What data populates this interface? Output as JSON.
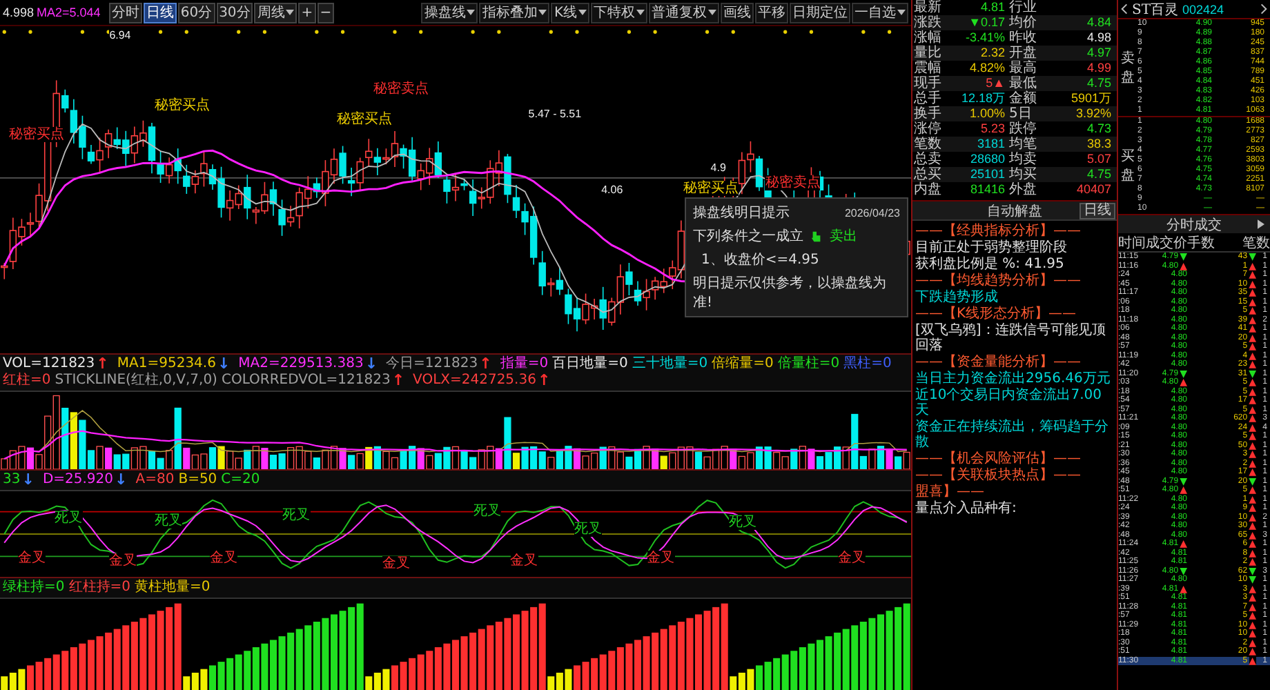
{
  "toolbar": {
    "readouts": [
      {
        "text": "4.998",
        "color": "#e8e8e8"
      },
      {
        "text": "MA2=5.044",
        "color": "#ff30ff"
      }
    ],
    "period_tabs": [
      {
        "label": "分时",
        "selected": false,
        "dropdown": false
      },
      {
        "label": "日线",
        "selected": true,
        "dropdown": false
      },
      {
        "label": "60分",
        "selected": false,
        "dropdown": false
      },
      {
        "label": "30分",
        "selected": false,
        "dropdown": false
      },
      {
        "label": "周线",
        "selected": false,
        "dropdown": true
      }
    ],
    "zoom_buttons": [
      "+",
      "−"
    ],
    "tools": [
      {
        "label": "操盘线",
        "dropdown": true
      },
      {
        "label": "指标叠加",
        "dropdown": true
      },
      {
        "label": "K线",
        "dropdown": true
      },
      {
        "label": "下特权",
        "dropdown": true
      },
      {
        "label": "普通复权",
        "dropdown": true
      },
      {
        "label": "画线",
        "dropdown": false
      },
      {
        "label": "平移",
        "dropdown": false
      },
      {
        "label": "日期定位",
        "dropdown": false
      },
      {
        "label": "一自选",
        "dropdown": true
      }
    ]
  },
  "main_chart": {
    "labels": [
      {
        "text": "秘密买点",
        "kind": "sell"
      },
      {
        "text": "秘密买点",
        "kind": "buy"
      },
      {
        "text": "秘密卖点",
        "kind": "sell"
      },
      {
        "text": "秘密买点",
        "kind": "buy"
      },
      {
        "text": "秘密买点",
        "kind": "buy"
      },
      {
        "text": "秘密卖点",
        "kind": "sell"
      }
    ],
    "price_marks": [
      "6.94",
      "5.47 - 5.51",
      "4.06",
      "4.9"
    ]
  },
  "volume_indicator": {
    "items": [
      {
        "text": "VOL=121823",
        "color": "#e8e8e8",
        "arrow": {
          "text": "↑",
          "color": "#ff3030"
        }
      },
      {
        "text": "MA1=95234.6",
        "color": "#e8c800",
        "arrow": {
          "text": "↓",
          "color": "#4080ff"
        }
      },
      {
        "text": "MA2=229513.383",
        "color": "#ff30ff",
        "arrow": {
          "text": "↓",
          "color": "#4080ff"
        }
      },
      {
        "text": "今日=121823",
        "color": "#a0a0a0",
        "arrow": {
          "text": "↑",
          "color": "#ff3030"
        }
      },
      {
        "text": "指量=0",
        "color": "#ff30ff"
      },
      {
        "text": "百日地量=0",
        "color": "#e8e8e8"
      },
      {
        "text": "三十地量=0",
        "color": "#00d8d8"
      },
      {
        "text": "倍缩量=0",
        "color": "#e8c800"
      },
      {
        "text": "倍量柱=0",
        "color": "#20e020"
      },
      {
        "text": "黑柱=0",
        "color": "#4060ff"
      },
      {
        "text": "红柱=0",
        "color": "#ff4040"
      },
      {
        "text": "STICKLINE(红柱,0,V,7,0)",
        "color": "#a0a0a0"
      },
      {
        "text": "COLORREDVOL=121823",
        "color": "#a0a0a0",
        "arrow": {
          "text": "↑",
          "color": "#ff3030"
        }
      },
      {
        "text": "VOLX=242725.36",
        "color": "#ff4040",
        "arrow": {
          "text": "↑",
          "color": "#ff3030"
        }
      }
    ]
  },
  "kdj_indicator": {
    "items": [
      {
        "text": "33",
        "color": "#20e020",
        "arrow": {
          "text": "↓",
          "color": "#4080ff"
        }
      },
      {
        "text": "D=25.920",
        "color": "#ff30ff",
        "arrow": {
          "text": "↓",
          "color": "#4080ff"
        }
      },
      {
        "text": "A=80",
        "color": "#ff4040"
      },
      {
        "text": "B=50",
        "color": "#e8c800"
      },
      {
        "text": "C=20",
        "color": "#20e020"
      }
    ],
    "labels": [
      {
        "text": "金叉",
        "kind": "golden"
      },
      {
        "text": "死叉",
        "kind": "death"
      },
      {
        "text": "金叉",
        "kind": "golden"
      },
      {
        "text": "死叉",
        "kind": "death"
      },
      {
        "text": "金叉",
        "kind": "golden"
      },
      {
        "text": "死叉",
        "kind": "death"
      },
      {
        "text": "金叉",
        "kind": "golden"
      },
      {
        "text": "死叉",
        "kind": "death"
      },
      {
        "text": "金叉",
        "kind": "golden"
      },
      {
        "text": "死叉",
        "kind": "death"
      },
      {
        "text": "金叉",
        "kind": "golden"
      },
      {
        "text": "死叉",
        "kind": "death"
      },
      {
        "text": "金叉",
        "kind": "golden"
      }
    ]
  },
  "bar_indicator": {
    "items": [
      {
        "text": "绿柱持=0",
        "color": "#20e020"
      },
      {
        "text": "红柱持=0",
        "color": "#ff4040"
      },
      {
        "text": "黄柱地量=0",
        "color": "#e8c800"
      }
    ]
  },
  "tooltip": {
    "title": "操盘线明日提示",
    "date": "2026/04/23",
    "condition": "下列条件之一成立",
    "signal": "卖出",
    "rule": "1、收盘价<=4.95",
    "note": "明日提示仅供参考，以操盘线为准!"
  },
  "quote": {
    "rows": [
      [
        {
          "label": "最新",
          "value": "4.81",
          "color": "#20e020"
        },
        {
          "label": "行业"
        }
      ],
      [
        {
          "label": "涨跌",
          "value": "▼0.17",
          "color": "#20e020"
        },
        {
          "label": "均价",
          "value": "4.84",
          "color": "#20e020"
        }
      ],
      [
        {
          "label": "涨幅",
          "value": "-3.41%",
          "color": "#20e020"
        },
        {
          "label": "昨收",
          "value": "4.98",
          "color": "#e8e8e8"
        }
      ],
      [
        {
          "label": "量比",
          "value": "2.32",
          "color": "#e8c800"
        },
        {
          "label": "开盘",
          "value": "4.97",
          "color": "#20e020"
        }
      ],
      [
        {
          "label": "震幅",
          "value": "4.82%",
          "color": "#e8c800"
        },
        {
          "label": "最高",
          "value": "4.99",
          "color": "#ff4040"
        }
      ],
      [
        {
          "label": "现手",
          "value": "5▲",
          "color": "#ff4040"
        },
        {
          "label": "最低",
          "value": "4.75",
          "color": "#20e020"
        }
      ],
      [
        {
          "label": "总手",
          "value": "12.18万",
          "color": "#00d8d8"
        },
        {
          "label": "金额",
          "value": "5901万",
          "color": "#e8c800"
        }
      ],
      [
        {
          "label": "换手",
          "value": "1.00%",
          "color": "#e8c800"
        },
        {
          "label": "5日",
          "value": "3.92%",
          "color": "#e8c800"
        }
      ],
      [
        {
          "label": "涨停",
          "value": "5.23",
          "color": "#ff4040"
        },
        {
          "label": "跌停",
          "value": "4.73",
          "color": "#20e020"
        }
      ],
      [
        {
          "label": "笔数",
          "value": "3181",
          "color": "#00d8d8"
        },
        {
          "label": "均笔",
          "value": "38.3",
          "color": "#e8c800"
        }
      ],
      [
        {
          "label": "总卖",
          "value": "28680",
          "color": "#00d8d8"
        },
        {
          "label": "均卖",
          "value": "5.07",
          "color": "#ff4040"
        }
      ],
      [
        {
          "label": "总买",
          "value": "25101",
          "color": "#00d8d8"
        },
        {
          "label": "均买",
          "value": "4.75",
          "color": "#20e020"
        }
      ],
      [
        {
          "label": "内盘",
          "value": "81416",
          "color": "#20e020"
        },
        {
          "label": "外盘",
          "value": "40407",
          "color": "#ff4040"
        }
      ]
    ]
  },
  "auto_analysis": {
    "title": "自动解盘",
    "button": "日线",
    "lines": [
      {
        "text": "——【经典指标分析】——",
        "kind": "heading"
      },
      {
        "text": "目前正处于弱势整理阶段",
        "kind": "normal"
      },
      {
        "text": "获利盘比例是 %: 41.95",
        "kind": "normal"
      },
      {
        "text": "——【均线趋势分析】——",
        "kind": "heading"
      },
      {
        "text": "下跌趋势形成",
        "kind": "highlight"
      },
      {
        "text": "——【K线形态分析】——",
        "kind": "heading"
      },
      {
        "text": "[双飞乌鸦]：连跌信号可能见顶回落",
        "kind": "normal"
      },
      {
        "text": "——【资金量能分析】——",
        "kind": "heading"
      },
      {
        "text": "当日主力资金流出2956.46万元",
        "kind": "highlight"
      },
      {
        "text": "近10个交易日内资金流出7.00天",
        "kind": "highlight"
      },
      {
        "text": "资金正在持续流出，筹码趋于分散",
        "kind": "highlight"
      },
      {
        "text": "——【机会风险评估】——",
        "kind": "heading"
      },
      {
        "text": "——【关联板块热点】——",
        "kind": "heading"
      },
      {
        "text": "盟喜】——",
        "kind": "heading"
      },
      {
        "text": "量点介入品种有:",
        "kind": "normal"
      }
    ]
  },
  "order_book": {
    "stock_name": "ST百灵",
    "code": "002424",
    "ask_label": "卖盘",
    "bid_label": "买盘",
    "asks": [
      {
        "rank": "10",
        "price": "4.90",
        "volume": "945"
      },
      {
        "rank": "9",
        "price": "4.89",
        "volume": "180"
      },
      {
        "rank": "8",
        "price": "4.88",
        "volume": "245"
      },
      {
        "rank": "7",
        "price": "4.87",
        "volume": "837"
      },
      {
        "rank": "6",
        "price": "4.86",
        "volume": "744"
      },
      {
        "rank": "5",
        "price": "4.85",
        "volume": "789"
      },
      {
        "rank": "4",
        "price": "4.84",
        "volume": "451"
      },
      {
        "rank": "3",
        "price": "4.83",
        "volume": "426"
      },
      {
        "rank": "2",
        "price": "4.82",
        "volume": "103"
      },
      {
        "rank": "1",
        "price": "4.81",
        "volume": "1063"
      }
    ],
    "bids": [
      {
        "rank": "1",
        "price": "4.80",
        "volume": "1688"
      },
      {
        "rank": "2",
        "price": "4.79",
        "volume": "2773"
      },
      {
        "rank": "3",
        "price": "4.78",
        "volume": "827"
      },
      {
        "rank": "4",
        "price": "4.77",
        "volume": "2593"
      },
      {
        "rank": "5",
        "price": "4.76",
        "volume": "3803"
      },
      {
        "rank": "6",
        "price": "4.75",
        "volume": "3059"
      },
      {
        "rank": "7",
        "price": "4.74",
        "volume": "2251"
      },
      {
        "rank": "8",
        "price": "4.73",
        "volume": "8107"
      },
      {
        "rank": "9",
        "price": "—",
        "volume": "—"
      },
      {
        "rank": "10",
        "price": "—",
        "volume": "—"
      }
    ]
  },
  "trades": {
    "title": "分时成交",
    "columns": [
      "时间",
      "成交价",
      "手数",
      "笔数"
    ],
    "rows": [
      {
        "time": "11:15",
        "price": "4.79",
        "price_arrow": {
          "text": "▼",
          "color": "#20e020"
        },
        "volume": "43",
        "volume_arrow": {
          "text": "▼",
          "color": "#20e020"
        },
        "count": "1",
        "selected": false
      },
      {
        "time": "11:16",
        "price": "4.80",
        "price_arrow": {
          "text": "▲",
          "color": "#ff3030"
        },
        "volume": "1",
        "volume_arrow": {
          "text": "▲",
          "color": "#ff3030"
        },
        "count": "1",
        "selected": false
      },
      {
        "time": ":24",
        "price": "4.80",
        "volume": "7",
        "volume_arrow": {
          "text": "▲",
          "color": "#ff3030"
        },
        "count": "1",
        "selected": false
      },
      {
        "time": ":45",
        "price": "4.80",
        "volume": "10",
        "volume_arrow": {
          "text": "▲",
          "color": "#ff3030"
        },
        "count": "1",
        "selected": false
      },
      {
        "time": "11:17",
        "price": "4.80",
        "volume": "35",
        "volume_arrow": {
          "text": "▲",
          "color": "#ff3030"
        },
        "count": "1",
        "selected": false
      },
      {
        "time": ":06",
        "price": "4.80",
        "volume": "15",
        "volume_arrow": {
          "text": "▲",
          "color": "#ff3030"
        },
        "count": "1",
        "selected": false
      },
      {
        "time": ":18",
        "price": "4.80",
        "volume": "5",
        "volume_arrow": {
          "text": "▲",
          "color": "#ff3030"
        },
        "count": "1",
        "selected": false
      },
      {
        "time": "11:18",
        "price": "4.80",
        "volume": "39",
        "volume_arrow": {
          "text": "▲",
          "color": "#ff3030"
        },
        "count": "2",
        "selected": false
      },
      {
        "time": ":06",
        "price": "4.80",
        "volume": "41",
        "volume_arrow": {
          "text": "▲",
          "color": "#ff3030"
        },
        "count": "1",
        "selected": false
      },
      {
        "time": ":48",
        "price": "4.80",
        "volume": "20",
        "volume_arrow": {
          "text": "▲",
          "color": "#ff3030"
        },
        "count": "1",
        "selected": false
      },
      {
        "time": ":57",
        "price": "4.80",
        "volume": "5",
        "volume_arrow": {
          "text": "▲",
          "color": "#ff3030"
        },
        "count": "1",
        "selected": false
      },
      {
        "time": "11:19",
        "price": "4.80",
        "volume": "4",
        "volume_arrow": {
          "text": "▲",
          "color": "#ff3030"
        },
        "count": "1",
        "selected": false
      },
      {
        "time": ":42",
        "price": "4.80",
        "volume": "23",
        "volume_arrow": {
          "text": "▲",
          "color": "#ff3030"
        },
        "count": "1",
        "selected": false
      },
      {
        "time": "11:20",
        "price": "4.79",
        "price_arrow": {
          "text": "▼",
          "color": "#20e020"
        },
        "volume": "31",
        "volume_arrow": {
          "text": "▼",
          "color": "#20e020"
        },
        "count": "1",
        "selected": false
      },
      {
        "time": ":03",
        "price": "4.80",
        "price_arrow": {
          "text": "▲",
          "color": "#ff3030"
        },
        "volume": "5",
        "volume_arrow": {
          "text": "▲",
          "color": "#ff3030"
        },
        "count": "1",
        "selected": false
      },
      {
        "time": ":18",
        "price": "4.80",
        "volume": "5",
        "volume_arrow": {
          "text": "▲",
          "color": "#ff3030"
        },
        "count": "1",
        "selected": false
      },
      {
        "time": ":54",
        "price": "4.80",
        "volume": "17",
        "volume_arrow": {
          "text": "▲",
          "color": "#ff3030"
        },
        "count": "1",
        "selected": false
      },
      {
        "time": ":57",
        "price": "4.80",
        "volume": "5",
        "volume_arrow": {
          "text": "▲",
          "color": "#ff3030"
        },
        "count": "1",
        "selected": false
      },
      {
        "time": "11:21",
        "price": "4.80",
        "volume": "620",
        "volume_arrow": {
          "text": "▲",
          "color": "#ff3030"
        },
        "count": "3",
        "selected": false
      },
      {
        "time": ":09",
        "price": "4.80",
        "volume": "24",
        "volume_arrow": {
          "text": "▲",
          "color": "#ff3030"
        },
        "count": "4",
        "selected": false
      },
      {
        "time": ":15",
        "price": "4.80",
        "volume": "5",
        "volume_arrow": {
          "text": "▲",
          "color": "#ff3030"
        },
        "count": "1",
        "selected": false
      },
      {
        "time": ":21",
        "price": "4.80",
        "volume": "50",
        "volume_arrow": {
          "text": "▲",
          "color": "#ff3030"
        },
        "count": "1",
        "selected": false
      },
      {
        "time": ":30",
        "price": "4.80",
        "volume": "3",
        "volume_arrow": {
          "text": "▲",
          "color": "#ff3030"
        },
        "count": "1",
        "selected": false
      },
      {
        "time": ":36",
        "price": "4.80",
        "volume": "2",
        "volume_arrow": {
          "text": "▲",
          "color": "#ff3030"
        },
        "count": "1",
        "selected": false
      },
      {
        "time": ":45",
        "price": "4.80",
        "volume": "17",
        "volume_arrow": {
          "text": "▲",
          "color": "#ff3030"
        },
        "count": "1",
        "selected": false
      },
      {
        "time": ":48",
        "price": "4.79",
        "price_arrow": {
          "text": "▼",
          "color": "#20e020"
        },
        "volume": "20",
        "volume_arrow": {
          "text": "▼",
          "color": "#20e020"
        },
        "count": "1",
        "selected": false
      },
      {
        "time": ":51",
        "price": "4.80",
        "price_arrow": {
          "text": "▲",
          "color": "#ff3030"
        },
        "volume": "5",
        "volume_arrow": {
          "text": "▲",
          "color": "#ff3030"
        },
        "count": "1",
        "selected": false
      },
      {
        "time": "11:22",
        "price": "4.80",
        "volume": "1",
        "volume_arrow": {
          "text": "▲",
          "color": "#ff3030"
        },
        "count": "1",
        "selected": false
      },
      {
        "time": ":24",
        "price": "4.80",
        "volume": "9",
        "volume_arrow": {
          "text": "▲",
          "color": "#ff3030"
        },
        "count": "1",
        "selected": false
      },
      {
        "time": ":39",
        "price": "4.80",
        "volume": "10",
        "volume_arrow": {
          "text": "▲",
          "color": "#ff3030"
        },
        "count": "2",
        "selected": false
      },
      {
        "time": ":42",
        "price": "4.80",
        "volume": "30",
        "volume_arrow": {
          "text": "▲",
          "color": "#ff3030"
        },
        "count": "1",
        "selected": false
      },
      {
        "time": ":48",
        "price": "4.80",
        "volume": "65",
        "volume_arrow": {
          "text": "▲",
          "color": "#ff3030"
        },
        "count": "3",
        "selected": false
      },
      {
        "time": "11:24",
        "price": "4.81",
        "price_arrow": {
          "text": "▲",
          "color": "#ff3030"
        },
        "volume": "6",
        "volume_arrow": {
          "text": "▲",
          "color": "#ff3030"
        },
        "count": "1",
        "selected": false
      },
      {
        "time": ":42",
        "price": "4.81",
        "volume": "8",
        "volume_arrow": {
          "text": "▲",
          "color": "#ff3030"
        },
        "count": "1",
        "selected": false
      },
      {
        "time": "11:25",
        "price": "4.81",
        "volume": "2",
        "volume_arrow": {
          "text": "▲",
          "color": "#ff3030"
        },
        "count": "1",
        "selected": false
      },
      {
        "time": "11:26",
        "price": "4.80",
        "price_arrow": {
          "text": "▼",
          "color": "#20e020"
        },
        "volume": "62",
        "volume_arrow": {
          "text": "▼",
          "color": "#20e020"
        },
        "count": "3",
        "selected": false
      },
      {
        "time": "11:27",
        "price": "4.80",
        "volume": "10",
        "volume_arrow": {
          "text": "▼",
          "color": "#20e020"
        },
        "count": "1",
        "selected": false
      },
      {
        "time": ":39",
        "price": "4.81",
        "price_arrow": {
          "text": "▲",
          "color": "#ff3030"
        },
        "volume": "3",
        "volume_arrow": {
          "text": "▲",
          "color": "#ff3030"
        },
        "count": "1",
        "selected": false
      },
      {
        "time": ":51",
        "price": "4.81",
        "volume": "3",
        "volume_arrow": {
          "text": "▲",
          "color": "#ff3030"
        },
        "count": "1",
        "selected": false
      },
      {
        "time": "11:28",
        "price": "4.81",
        "volume": "7",
        "volume_arrow": {
          "text": "▲",
          "color": "#ff3030"
        },
        "count": "1",
        "selected": false
      },
      {
        "time": ":57",
        "price": "4.81",
        "volume": "5",
        "volume_arrow": {
          "text": "▲",
          "color": "#ff3030"
        },
        "count": "1",
        "selected": false
      },
      {
        "time": "11:29",
        "price": "4.81",
        "volume": "10",
        "volume_arrow": {
          "text": "▲",
          "color": "#ff3030"
        },
        "count": "1",
        "selected": false
      },
      {
        "time": ":18",
        "price": "4.81",
        "volume": "10",
        "volume_arrow": {
          "text": "▲",
          "color": "#ff3030"
        },
        "count": "1",
        "selected": false
      },
      {
        "time": ":30",
        "price": "4.81",
        "volume": "2",
        "volume_arrow": {
          "text": "▲",
          "color": "#ff3030"
        },
        "count": "1",
        "selected": false
      },
      {
        "time": ":51",
        "price": "4.81",
        "volume": "20",
        "volume_arrow": {
          "text": "▲",
          "color": "#ff3030"
        },
        "count": "1",
        "selected": false
      },
      {
        "time": "11:30",
        "price": "4.81",
        "volume": "5",
        "volume_arrow": {
          "text": "▲",
          "color": "#ff3030"
        },
        "count": "1",
        "selected": true
      }
    ]
  }
}
